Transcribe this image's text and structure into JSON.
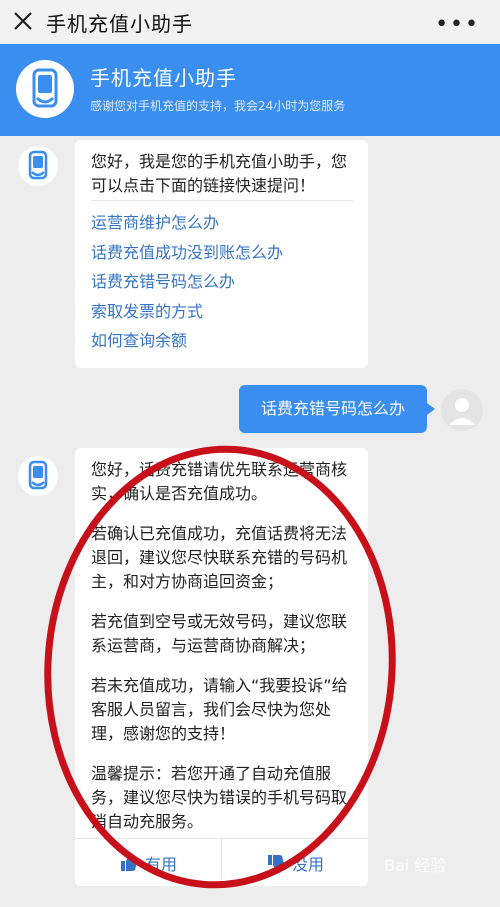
{
  "topbar": {
    "title": "手机充值小助手",
    "more": "•••"
  },
  "banner": {
    "title": "手机充值小助手",
    "subtitle": "感谢您对手机充值的支持，我会24小时为您服务"
  },
  "message1": {
    "greeting": "您好，我是您的手机充值小助手，您可以点击下面的链接快速提问！",
    "links": [
      "运营商维护怎么办",
      "话费充值成功没到账怎么办",
      "话费充错号码怎么办",
      "索取发票的方式",
      "如何查询余额"
    ]
  },
  "user_message": "话费充错号码怎么办",
  "message2": {
    "paragraphs": [
      "您好，话费充错请优先联系运营商核实，确认是否充值成功。",
      "若确认已充值成功，充值话费将无法退回，建议您尽快联系充错的号码机主，和对方协商追回资金；",
      "若充值到空号或无效号码，建议您联系运营商，与运营商协商解决；",
      "若未充值成功，请输入“我要投诉”给客服人员留言，我们会尽快为您处理，感谢您的支持！",
      "温馨提示：若您开通了自动充值服务，建议您尽快为错误的手机号码取消自动充服务。"
    ],
    "helpful": "有用",
    "not_helpful": "没用"
  },
  "watermark": "Bai 经验"
}
